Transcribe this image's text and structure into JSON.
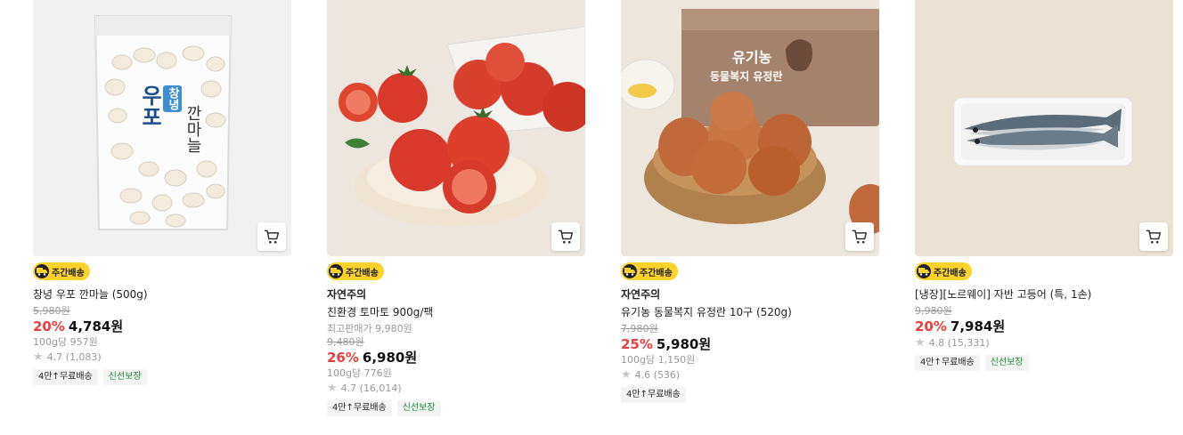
{
  "colors": {
    "discount": "#f03c3c",
    "badge": "#fdd22a",
    "fresh_tag": "#1a8a3a"
  },
  "products": [
    {
      "badge": "주간배송",
      "brand": "",
      "name": "창녕 우포 깐마늘 (500g)",
      "max_price": "",
      "original_price": "5,980원",
      "discount": "20%",
      "price": "4,784원",
      "unit_price": "100g당 957원",
      "rating": "4.7 (1,083)",
      "tags": [
        "4만↑무료배송",
        "신선보장"
      ],
      "image_icon": "garlic-bag",
      "package_text": [
        "우포",
        "창녕",
        "깐마늘"
      ]
    },
    {
      "badge": "주간배송",
      "brand": "자연주의",
      "name": "친환경 토마토 900g/팩",
      "max_price": "최고판매가 9,980원",
      "original_price": "9,480원",
      "discount": "26%",
      "price": "6,980원",
      "unit_price": "100g당 776원",
      "rating": "4.7 (16,014)",
      "tags": [
        "4만↑무료배송",
        "신선보장"
      ],
      "image_icon": "tomatoes"
    },
    {
      "badge": "주간배송",
      "brand": "자연주의",
      "name": "유기농 동물복지 유정란 10구 (520g)",
      "max_price": "",
      "original_price": "7,980원",
      "discount": "25%",
      "price": "5,980원",
      "unit_price": "100g당 1,150원",
      "rating": "4.6 (536)",
      "tags": [
        "4만↑무료배송"
      ],
      "image_icon": "eggs",
      "package_text": [
        "유기농",
        "동물복지 유정란"
      ]
    },
    {
      "badge": "주간배송",
      "brand": "",
      "name": "[냉장][노르웨이] 자반 고등어 (특, 1손)",
      "max_price": "",
      "original_price": "9,980원",
      "discount": "20%",
      "price": "7,984원",
      "unit_price": "",
      "rating": "4.8 (15,331)",
      "tags": [
        "4만↑무료배송",
        "신선보장"
      ],
      "image_icon": "mackerel"
    }
  ]
}
